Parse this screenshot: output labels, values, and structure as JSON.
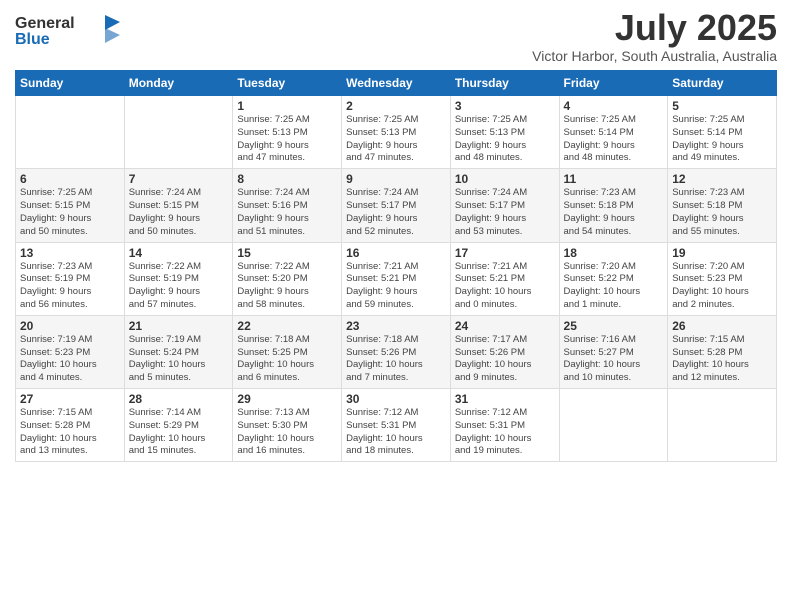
{
  "logo": {
    "general": "General",
    "blue": "Blue"
  },
  "title": "July 2025",
  "location": "Victor Harbor, South Australia, Australia",
  "weekdays": [
    "Sunday",
    "Monday",
    "Tuesday",
    "Wednesday",
    "Thursday",
    "Friday",
    "Saturday"
  ],
  "weeks": [
    [
      {
        "day": "",
        "info": ""
      },
      {
        "day": "",
        "info": ""
      },
      {
        "day": "1",
        "info": "Sunrise: 7:25 AM\nSunset: 5:13 PM\nDaylight: 9 hours\nand 47 minutes."
      },
      {
        "day": "2",
        "info": "Sunrise: 7:25 AM\nSunset: 5:13 PM\nDaylight: 9 hours\nand 47 minutes."
      },
      {
        "day": "3",
        "info": "Sunrise: 7:25 AM\nSunset: 5:13 PM\nDaylight: 9 hours\nand 48 minutes."
      },
      {
        "day": "4",
        "info": "Sunrise: 7:25 AM\nSunset: 5:14 PM\nDaylight: 9 hours\nand 48 minutes."
      },
      {
        "day": "5",
        "info": "Sunrise: 7:25 AM\nSunset: 5:14 PM\nDaylight: 9 hours\nand 49 minutes."
      }
    ],
    [
      {
        "day": "6",
        "info": "Sunrise: 7:25 AM\nSunset: 5:15 PM\nDaylight: 9 hours\nand 50 minutes."
      },
      {
        "day": "7",
        "info": "Sunrise: 7:24 AM\nSunset: 5:15 PM\nDaylight: 9 hours\nand 50 minutes."
      },
      {
        "day": "8",
        "info": "Sunrise: 7:24 AM\nSunset: 5:16 PM\nDaylight: 9 hours\nand 51 minutes."
      },
      {
        "day": "9",
        "info": "Sunrise: 7:24 AM\nSunset: 5:17 PM\nDaylight: 9 hours\nand 52 minutes."
      },
      {
        "day": "10",
        "info": "Sunrise: 7:24 AM\nSunset: 5:17 PM\nDaylight: 9 hours\nand 53 minutes."
      },
      {
        "day": "11",
        "info": "Sunrise: 7:23 AM\nSunset: 5:18 PM\nDaylight: 9 hours\nand 54 minutes."
      },
      {
        "day": "12",
        "info": "Sunrise: 7:23 AM\nSunset: 5:18 PM\nDaylight: 9 hours\nand 55 minutes."
      }
    ],
    [
      {
        "day": "13",
        "info": "Sunrise: 7:23 AM\nSunset: 5:19 PM\nDaylight: 9 hours\nand 56 minutes."
      },
      {
        "day": "14",
        "info": "Sunrise: 7:22 AM\nSunset: 5:19 PM\nDaylight: 9 hours\nand 57 minutes."
      },
      {
        "day": "15",
        "info": "Sunrise: 7:22 AM\nSunset: 5:20 PM\nDaylight: 9 hours\nand 58 minutes."
      },
      {
        "day": "16",
        "info": "Sunrise: 7:21 AM\nSunset: 5:21 PM\nDaylight: 9 hours\nand 59 minutes."
      },
      {
        "day": "17",
        "info": "Sunrise: 7:21 AM\nSunset: 5:21 PM\nDaylight: 10 hours\nand 0 minutes."
      },
      {
        "day": "18",
        "info": "Sunrise: 7:20 AM\nSunset: 5:22 PM\nDaylight: 10 hours\nand 1 minute."
      },
      {
        "day": "19",
        "info": "Sunrise: 7:20 AM\nSunset: 5:23 PM\nDaylight: 10 hours\nand 2 minutes."
      }
    ],
    [
      {
        "day": "20",
        "info": "Sunrise: 7:19 AM\nSunset: 5:23 PM\nDaylight: 10 hours\nand 4 minutes."
      },
      {
        "day": "21",
        "info": "Sunrise: 7:19 AM\nSunset: 5:24 PM\nDaylight: 10 hours\nand 5 minutes."
      },
      {
        "day": "22",
        "info": "Sunrise: 7:18 AM\nSunset: 5:25 PM\nDaylight: 10 hours\nand 6 minutes."
      },
      {
        "day": "23",
        "info": "Sunrise: 7:18 AM\nSunset: 5:26 PM\nDaylight: 10 hours\nand 7 minutes."
      },
      {
        "day": "24",
        "info": "Sunrise: 7:17 AM\nSunset: 5:26 PM\nDaylight: 10 hours\nand 9 minutes."
      },
      {
        "day": "25",
        "info": "Sunrise: 7:16 AM\nSunset: 5:27 PM\nDaylight: 10 hours\nand 10 minutes."
      },
      {
        "day": "26",
        "info": "Sunrise: 7:15 AM\nSunset: 5:28 PM\nDaylight: 10 hours\nand 12 minutes."
      }
    ],
    [
      {
        "day": "27",
        "info": "Sunrise: 7:15 AM\nSunset: 5:28 PM\nDaylight: 10 hours\nand 13 minutes."
      },
      {
        "day": "28",
        "info": "Sunrise: 7:14 AM\nSunset: 5:29 PM\nDaylight: 10 hours\nand 15 minutes."
      },
      {
        "day": "29",
        "info": "Sunrise: 7:13 AM\nSunset: 5:30 PM\nDaylight: 10 hours\nand 16 minutes."
      },
      {
        "day": "30",
        "info": "Sunrise: 7:12 AM\nSunset: 5:31 PM\nDaylight: 10 hours\nand 18 minutes."
      },
      {
        "day": "31",
        "info": "Sunrise: 7:12 AM\nSunset: 5:31 PM\nDaylight: 10 hours\nand 19 minutes."
      },
      {
        "day": "",
        "info": ""
      },
      {
        "day": "",
        "info": ""
      }
    ]
  ]
}
